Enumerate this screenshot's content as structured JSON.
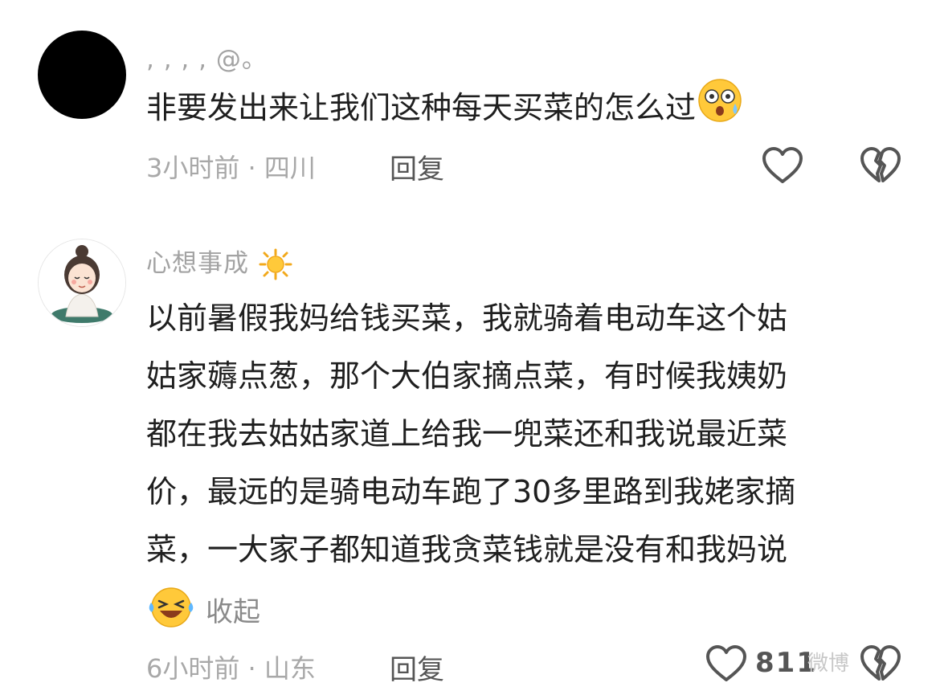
{
  "comments": [
    {
      "username": ", , , , @。",
      "avatar_icon": "black-circle-avatar",
      "text": "非要发出来让我们这种每天买菜的怎么过",
      "text_emoji": "surprised-sweat-emoji",
      "time": "3小时前",
      "separator": "·",
      "location": "四川",
      "reply_label": "回复",
      "like_icon": "heart-outline-icon",
      "dislike_icon": "broken-heart-icon"
    },
    {
      "username": "心想事成",
      "username_emoji": "sun-emoji",
      "avatar_icon": "cartoon-girl-avatar",
      "lines": [
        "以前暑假我妈给钱买菜，我就骑着电动车这个姑",
        "姑家薅点葱，那个大伯家摘点菜，有时候我姨奶",
        "都在我去姑姑家道上给我一兜菜还和我说最近菜",
        "价，最远的是骑电动车跑了30多里路到我姥家摘",
        "菜，一大家子都知道我贪菜钱就是没有和我妈说"
      ],
      "collapse_emoji": "laughing-crying-emoji",
      "collapse_label": "收起",
      "time": "6小时前",
      "separator": "·",
      "location": "山东",
      "reply_label": "回复",
      "like_icon": "heart-outline-icon",
      "like_count": "811",
      "dislike_icon": "broken-heart-icon"
    }
  ],
  "watermark": "微博",
  "colors": {
    "meta_gray": "#a8a8a8",
    "text_dark": "#1f1f1f",
    "icon_gray": "#555555",
    "emoji_yellow": "#ffc93a"
  }
}
